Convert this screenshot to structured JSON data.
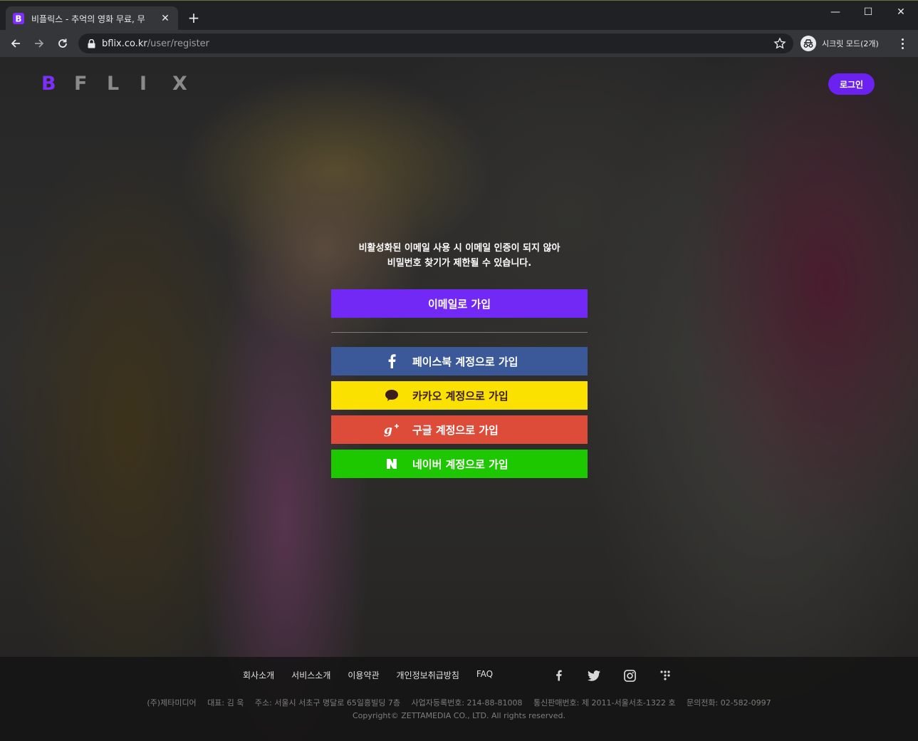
{
  "browser": {
    "tab_title": "비플릭스 - 추억의 영화 무료, 무",
    "url_host": "bflix.co.kr",
    "url_path": "/user/register",
    "incognito_label": "시크릿 모드(2개)"
  },
  "header": {
    "logo_letters": [
      "B",
      "F",
      "L",
      "I",
      "X"
    ],
    "login_label": "로그인"
  },
  "main": {
    "notice_line1": "비활성화된 이메일 사용 시 이메일 인증이 되지 않아",
    "notice_line2": "비밀번호 찾기가 제한될 수 있습니다.",
    "email_signup": "이메일로 가입",
    "facebook_signup": "페이스북 계정으로 가입",
    "kakao_signup": "카카오 계정으로 가입",
    "google_signup": "구글 계정으로 가입",
    "naver_signup": "네이버 계정으로 가입"
  },
  "footer": {
    "links": [
      "회사소개",
      "서비스소개",
      "이용약관",
      "개인정보취급방침",
      "FAQ"
    ],
    "company": "(주)제타미디어",
    "ceo": "대표: 김 욱",
    "address": "주소: 서울시 서초구 명달로 65일흥빌딩 7층",
    "biz_no": "사업자등록번호: 214-88-81008",
    "mail_order_no": "통신판매번호: 제 2011-서울서초-1322 호",
    "phone": "문의전화: 02-582-0997",
    "copyright": "Copyright© ZETTAMEDIA CO., LTD. All rights reserved."
  },
  "colors": {
    "brand": "#7329f5",
    "facebook": "#3b5998",
    "kakao": "#fae100",
    "google": "#dd4b39",
    "naver": "#1ec800"
  }
}
